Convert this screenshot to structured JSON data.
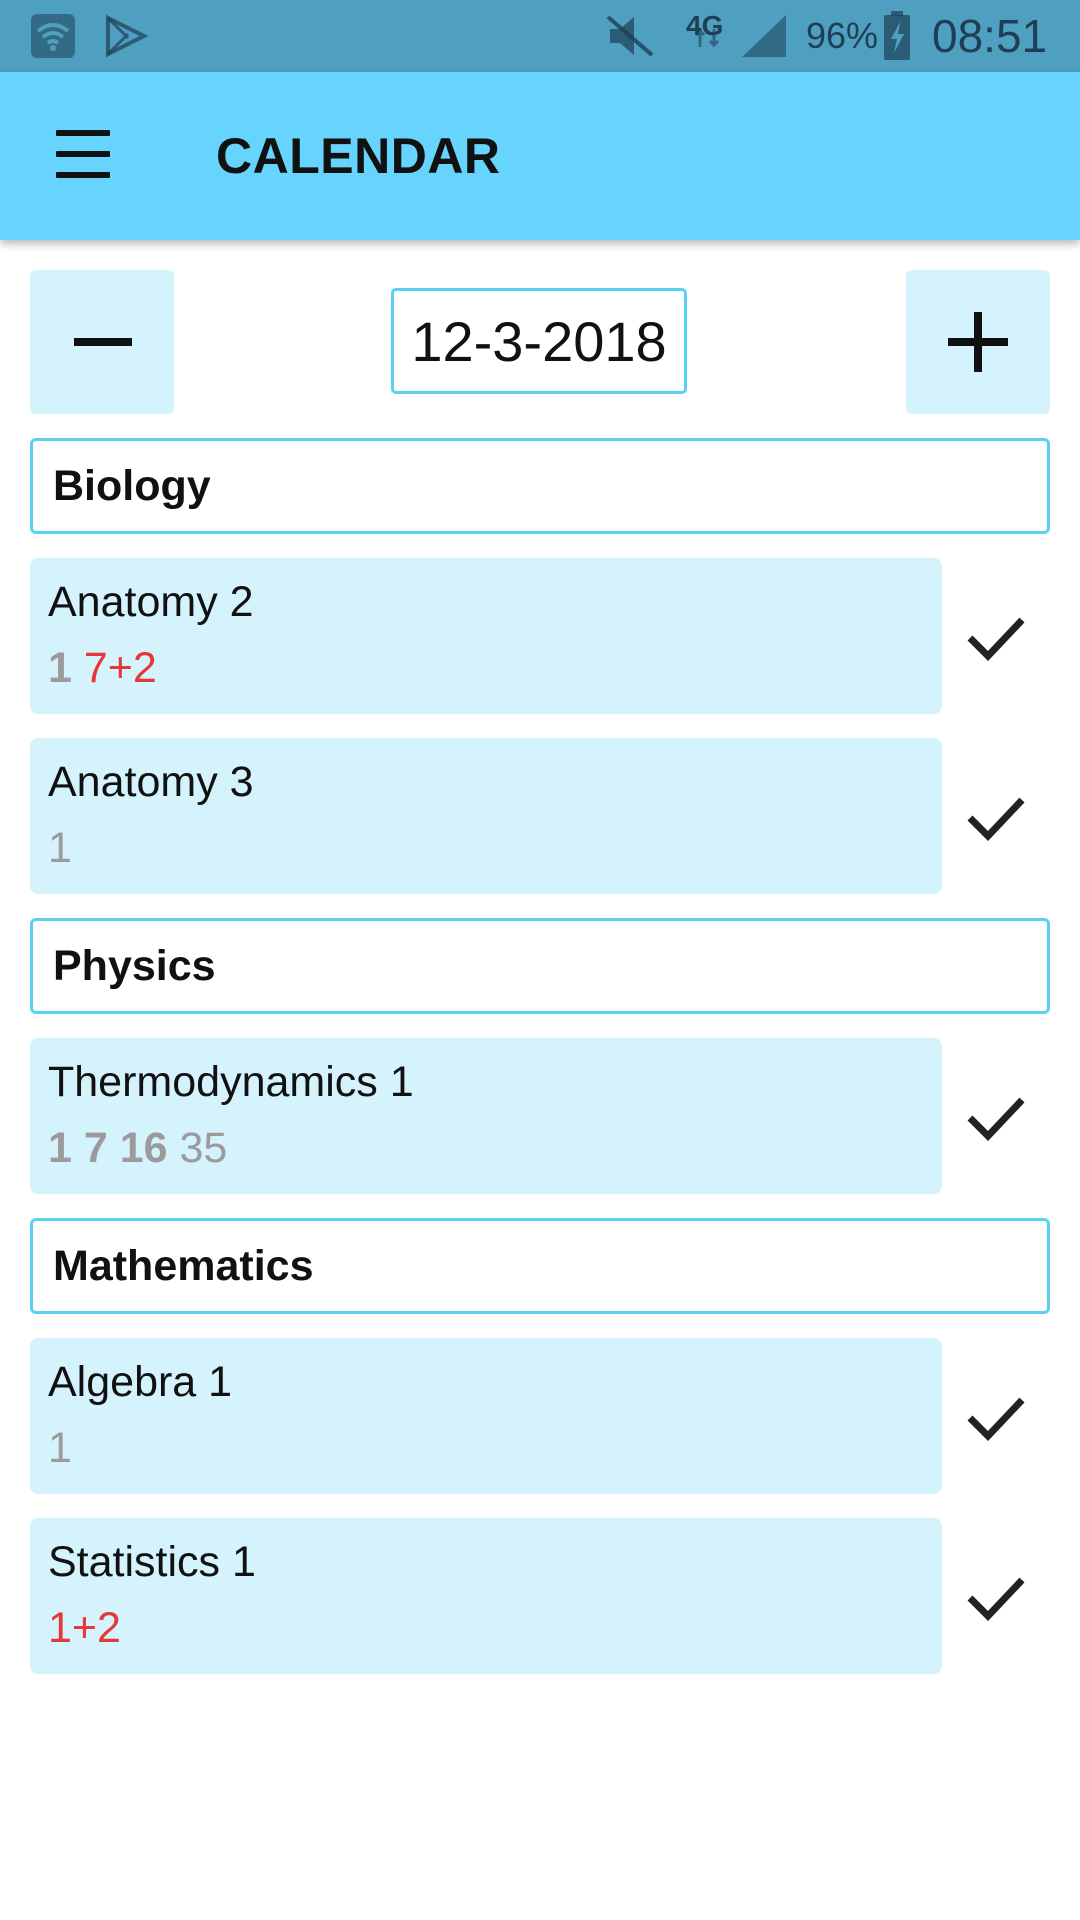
{
  "status_bar": {
    "network": "4G",
    "battery": "96%",
    "time": "08:51"
  },
  "app_bar": {
    "title": "CALENDAR"
  },
  "date_nav": {
    "date": "12-3-2018"
  },
  "sections": [
    {
      "name": "Biology",
      "items": [
        {
          "title": "Anatomy 2",
          "sub": [
            {
              "text": "1",
              "style": "greyb"
            },
            {
              "text": " ",
              "style": "grey"
            },
            {
              "text": "7+2",
              "style": "red"
            }
          ]
        },
        {
          "title": "Anatomy 3",
          "sub": [
            {
              "text": "1",
              "style": "grey"
            }
          ]
        }
      ]
    },
    {
      "name": "Physics",
      "items": [
        {
          "title": "Thermodynamics 1",
          "sub": [
            {
              "text": "1 7 16",
              "style": "greyb"
            },
            {
              "text": " 35",
              "style": "grey"
            }
          ]
        }
      ]
    },
    {
      "name": "Mathematics",
      "items": [
        {
          "title": "Algebra 1",
          "sub": [
            {
              "text": "1",
              "style": "grey"
            }
          ]
        },
        {
          "title": "Statistics 1",
          "sub": [
            {
              "text": "1+2",
              "style": "red"
            }
          ]
        }
      ]
    }
  ],
  "colors": {
    "status_bar": "#4f9fc1",
    "app_bar": "#66d4fd",
    "item_bg": "#d4f3fd",
    "border": "#5ad0f3",
    "overdue": "#e53935"
  }
}
